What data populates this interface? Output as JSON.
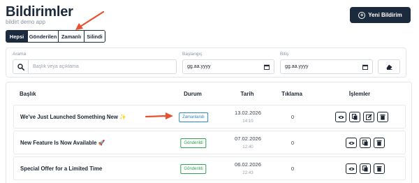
{
  "header": {
    "title": "Bildirimler",
    "subtitle": "bildirt demo app",
    "new_button_label": "Yeni Bildirim"
  },
  "tabs": [
    {
      "label": "Hepsi",
      "active": true
    },
    {
      "label": "Gönderilen",
      "active": false
    },
    {
      "label": "Zamanlı",
      "active": false
    },
    {
      "label": "Silindi",
      "active": false
    }
  ],
  "filters": {
    "search_label": "Arama",
    "search_placeholder": "Başlık veya açıklama",
    "start_label": "Başlangıç",
    "start_value": "gg.aa.yyyy",
    "end_label": "Bitiş",
    "end_value": "gg.aa.yyyy"
  },
  "table": {
    "columns": [
      "Başlık",
      "Durum",
      "Tarih",
      "Tıklama",
      "İşlemler"
    ],
    "rows": [
      {
        "title": "We've Just Launched Something New",
        "emoji": "✨",
        "status": "Zamanlandı",
        "status_type": "scheduled",
        "date": "13.02.2026",
        "time": "14:10",
        "clicks": "0"
      },
      {
        "title": "New Feature Is Now Available",
        "emoji": "🚀",
        "status": "Gönderildi",
        "status_type": "sent",
        "date": "07.02.2026",
        "time": "12:40",
        "clicks": "0"
      },
      {
        "title": "Special Offer for a Limited Time",
        "emoji": "",
        "status": "Gönderildi",
        "status_type": "sent",
        "date": "06.02.2026",
        "time": "22:43",
        "clicks": "0"
      }
    ]
  },
  "colors": {
    "primary": "#1c2a3d",
    "scheduled": "#2a88c8",
    "sent": "#2ea44f",
    "annotation_arrow": "#e8502f"
  },
  "icons": {
    "new": "plus-circle-icon",
    "search": "search-icon",
    "calendar": "calendar-icon",
    "clear": "eraser-icon",
    "view": "eye-icon",
    "copy": "copy-icon",
    "edit": "edit-icon",
    "delete": "trash-icon"
  }
}
